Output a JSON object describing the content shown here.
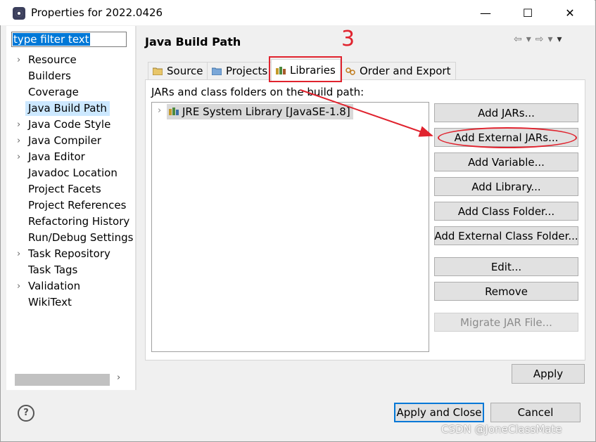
{
  "window": {
    "title": "Properties for 2022.0426",
    "minimize": "—",
    "maximize": "☐",
    "close": "✕"
  },
  "filter": {
    "placeholder": "type filter text"
  },
  "sidebar": {
    "items": [
      {
        "label": "Resource",
        "expandable": true
      },
      {
        "label": "Builders",
        "expandable": false
      },
      {
        "label": "Coverage",
        "expandable": false
      },
      {
        "label": "Java Build Path",
        "expandable": false,
        "selected": true
      },
      {
        "label": "Java Code Style",
        "expandable": true
      },
      {
        "label": "Java Compiler",
        "expandable": true
      },
      {
        "label": "Java Editor",
        "expandable": true
      },
      {
        "label": "Javadoc Location",
        "expandable": false
      },
      {
        "label": "Project Facets",
        "expandable": false
      },
      {
        "label": "Project References",
        "expandable": false
      },
      {
        "label": "Refactoring History",
        "expandable": false
      },
      {
        "label": "Run/Debug Settings",
        "expandable": false
      },
      {
        "label": "Task Repository",
        "expandable": true
      },
      {
        "label": "Task Tags",
        "expandable": false
      },
      {
        "label": "Validation",
        "expandable": true
      },
      {
        "label": "WikiText",
        "expandable": false
      }
    ]
  },
  "page": {
    "title": "Java Build Path"
  },
  "tabs": [
    {
      "label": "Source",
      "icon": "source-folder-icon"
    },
    {
      "label": "Projects",
      "icon": "projects-icon"
    },
    {
      "label": "Libraries",
      "icon": "libraries-icon",
      "active": true
    },
    {
      "label": "Order and Export",
      "icon": "order-export-icon"
    }
  ],
  "libraries": {
    "label": "JARs and class folders on the build path:",
    "entries": [
      {
        "label": "JRE System Library [JavaSE-1.8]"
      }
    ]
  },
  "buttons": {
    "add_jars": "Add JARs...",
    "add_external_jars": "Add External JARs...",
    "add_variable": "Add Variable...",
    "add_library": "Add Library...",
    "add_class_folder": "Add Class Folder...",
    "add_external_class_folder": "Add External Class Folder...",
    "edit": "Edit...",
    "remove": "Remove",
    "migrate_jar": "Migrate JAR File..."
  },
  "footer": {
    "apply": "Apply",
    "apply_and_close": "Apply and Close",
    "cancel": "Cancel",
    "help": "?"
  },
  "annotation": {
    "step_number": "3"
  },
  "watermark": "CSDN @JoneClassMate",
  "colors": {
    "annotation_red": "#e0232e",
    "selection_blue": "#0078d7",
    "selected_item": "#cce8ff"
  }
}
